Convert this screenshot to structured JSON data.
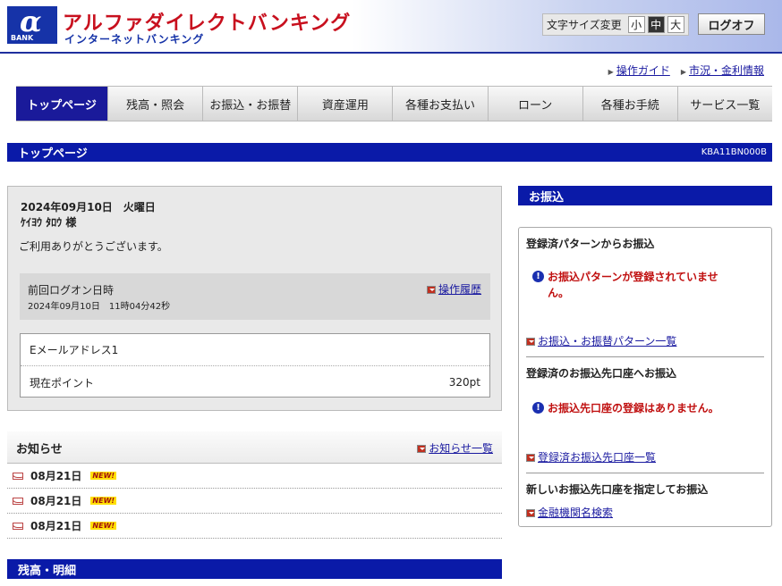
{
  "header": {
    "logo_text": "BANK",
    "brand_main": "アルファダイレクトバンキング",
    "brand_sub": "インターネットバンキング",
    "fontsize_label": "文字サイズ変更",
    "fontsize_small": "小",
    "fontsize_medium": "中",
    "fontsize_large": "大",
    "logoff_label": "ログオフ"
  },
  "top_links": {
    "guide": "操作ガイド",
    "market": "市況・金利情報"
  },
  "nav": {
    "items": [
      "トップページ",
      "残高・照会",
      "お振込・お振替",
      "資産運用",
      "各種お支払い",
      "ローン",
      "各種お手続",
      "サービス一覧"
    ]
  },
  "page": {
    "title": "トップページ",
    "code": "KBA11BN000B"
  },
  "welcome": {
    "date": "2024年09月10日　火曜日",
    "name": "ｹｲﾖｳ ﾀﾛｳ 様",
    "message": "ご利用ありがとうございます。",
    "last_login_label": "前回ログオン日時",
    "last_login_value": "2024年09月10日　11時04分42秒",
    "history_link": "操作履歴",
    "email_label": "Eメールアドレス1",
    "points_label": "現在ポイント",
    "points_value": "320pt"
  },
  "news": {
    "title": "お知らせ",
    "more_link": "お知らせ一覧",
    "new_badge": "NEW!",
    "items": [
      {
        "date": "08月21日"
      },
      {
        "date": "08月21日"
      },
      {
        "date": "08月21日"
      }
    ]
  },
  "balance": {
    "title": "残高・明細"
  },
  "transfer": {
    "title": "お振込",
    "pattern_title": "登録済パターンからお振込",
    "pattern_warning": "お振込パターンが登録されていません。",
    "pattern_link": "お振込・お振替パターン一覧",
    "registered_title": "登録済のお振込先口座へお振込",
    "registered_warning": "お振込先口座の登録はありません。",
    "registered_link": "登録済お振込先口座一覧",
    "new_title": "新しいお振込先口座を指定してお振込",
    "search_link": "金融機関名検索"
  }
}
